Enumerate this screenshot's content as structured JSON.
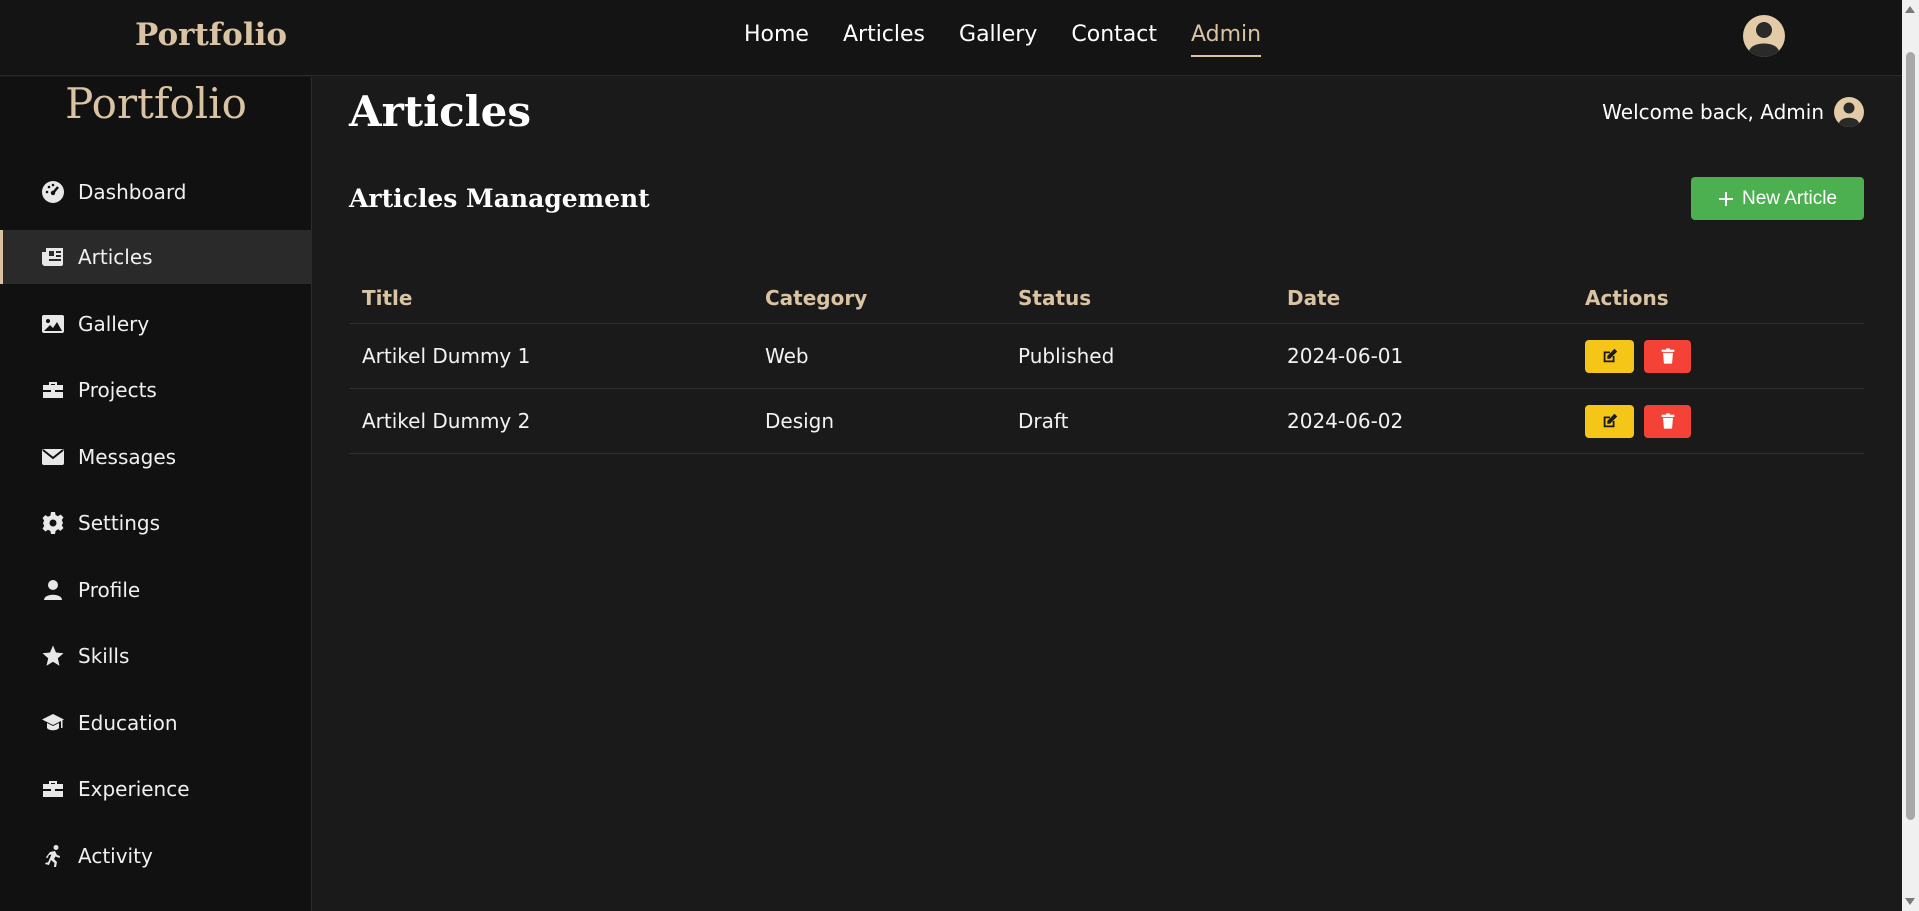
{
  "header": {
    "brand": "Portfolio",
    "nav": [
      "Home",
      "Articles",
      "Gallery",
      "Contact",
      "Admin"
    ],
    "active_nav": "Admin"
  },
  "sidebar": {
    "brand": "Portfolio",
    "items": [
      {
        "label": "Dashboard",
        "icon": "gauge-icon"
      },
      {
        "label": "Articles",
        "icon": "newspaper-icon"
      },
      {
        "label": "Gallery",
        "icon": "image-icon"
      },
      {
        "label": "Projects",
        "icon": "briefcase-icon"
      },
      {
        "label": "Messages",
        "icon": "envelope-icon"
      },
      {
        "label": "Settings",
        "icon": "gear-icon"
      },
      {
        "label": "Profile",
        "icon": "user-icon"
      },
      {
        "label": "Skills",
        "icon": "star-icon"
      },
      {
        "label": "Education",
        "icon": "graduation-cap-icon"
      },
      {
        "label": "Experience",
        "icon": "briefcase-icon"
      },
      {
        "label": "Activity",
        "icon": "running-icon"
      }
    ],
    "active_item": "Articles"
  },
  "main": {
    "title": "Articles",
    "welcome": "Welcome back, Admin",
    "section_title": "Articles Management",
    "new_button": "New Article",
    "table": {
      "headers": [
        "Title",
        "Category",
        "Status",
        "Date",
        "Actions"
      ],
      "rows": [
        {
          "title": "Artikel Dummy 1",
          "category": "Web",
          "status": "Published",
          "date": "2024-06-01"
        },
        {
          "title": "Artikel Dummy 2",
          "category": "Design",
          "status": "Draft",
          "date": "2024-06-02"
        }
      ]
    }
  },
  "colors": {
    "accent": "#d9c3a2",
    "new_button": "#4caf50",
    "edit_button": "#f5c518",
    "delete_button": "#f44336"
  }
}
